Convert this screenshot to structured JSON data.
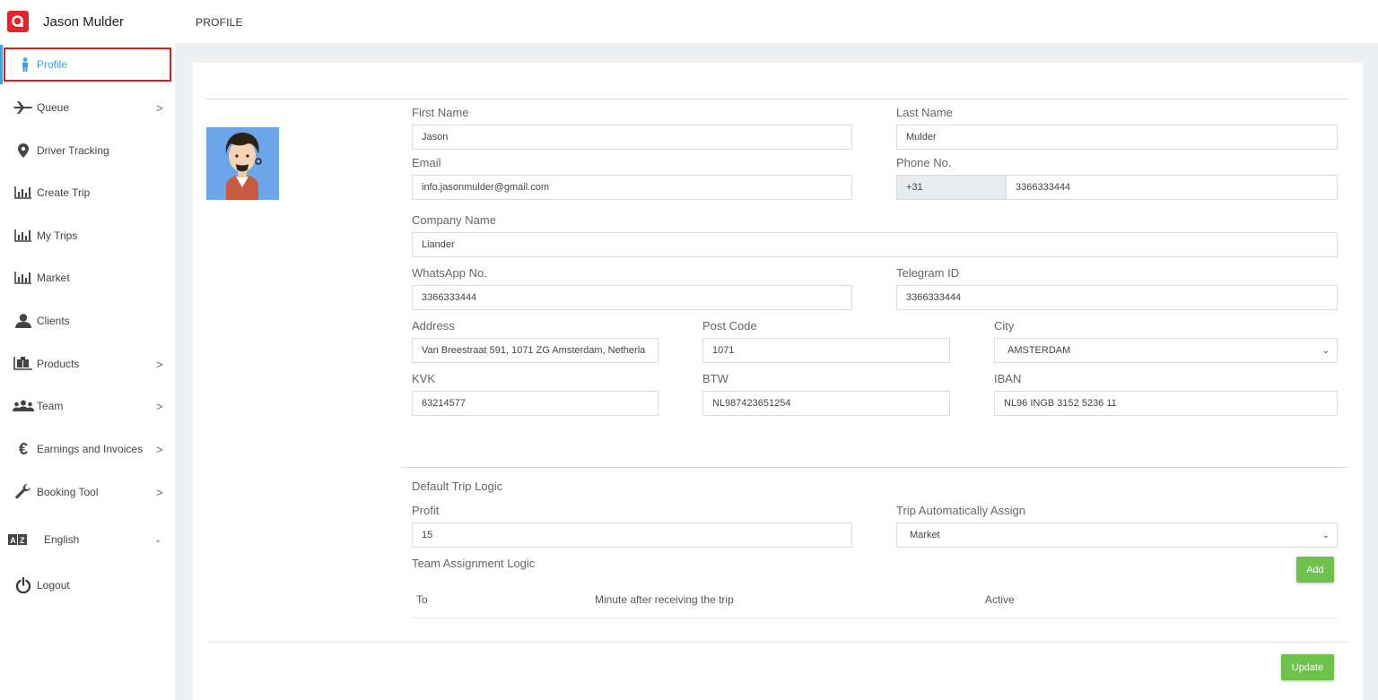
{
  "app": {
    "user_name": "Jason Mulder"
  },
  "topbar": {
    "breadcrumb": "PROFILE"
  },
  "sidebar": {
    "items": [
      {
        "label": "Profile",
        "icon": "person-icon"
      },
      {
        "label": "Queue",
        "icon": "plane-icon"
      },
      {
        "label": "Driver Tracking",
        "icon": "map-pin-icon"
      },
      {
        "label": "Create Trip",
        "icon": "bar-chart-icon"
      },
      {
        "label": "My Trips",
        "icon": "bar-chart-icon"
      },
      {
        "label": "Market",
        "icon": "bar-chart-icon"
      },
      {
        "label": "Clients",
        "icon": "user-icon"
      },
      {
        "label": "Products",
        "icon": "products-icon"
      },
      {
        "label": "Team",
        "icon": "team-icon"
      },
      {
        "label": "Earnings and Invoices",
        "icon": "euro-icon"
      },
      {
        "label": "Booking Tool",
        "icon": "wrench-icon"
      },
      {
        "label": "English",
        "icon": "translate-icon"
      },
      {
        "label": "Logout",
        "icon": "power-icon"
      }
    ]
  },
  "form": {
    "first_name": {
      "label": "First Name",
      "value": "Jason"
    },
    "last_name": {
      "label": "Last Name",
      "value": "Mulder"
    },
    "email": {
      "label": "Email",
      "value": "info.jasonmulder@gmail.com"
    },
    "phone": {
      "label": "Phone No.",
      "prefix": "+31",
      "value": "3366333444"
    },
    "company": {
      "label": "Company Name",
      "value": "Liander"
    },
    "whatsapp": {
      "label": "WhatsApp No.",
      "value": "3366333444"
    },
    "telegram": {
      "label": "Telegram ID",
      "value": "3366333444"
    },
    "address": {
      "label": "Address",
      "value": "Van Breestraat 591, 1071 ZG Amsterdam, Netherla"
    },
    "postcode": {
      "label": "Post Code",
      "value": "1071"
    },
    "city": {
      "label": "City",
      "value": "AMSTERDAM"
    },
    "kvk": {
      "label": "KVK",
      "value": "63214577"
    },
    "btw": {
      "label": "BTW",
      "value": "NL987423651254"
    },
    "iban": {
      "label": "IBAN",
      "value": "NL96 INGB 3152 5236 11"
    }
  },
  "trip_logic": {
    "section_title": "Default Trip Logic",
    "profit": {
      "label": "Profit",
      "value": "15"
    },
    "auto_assign": {
      "label": "Trip Automatically Assign",
      "value": "Market"
    },
    "team_logic_title": "Team Assignment Logic",
    "add_label": "Add",
    "columns": [
      "To",
      "Minute after receiving the trip",
      "Active"
    ]
  },
  "update_label": "Update",
  "colors": {
    "accent": "#3aa4dc",
    "brand": "#e0262b",
    "button": "#6cc24a",
    "highlight_border": "#e21b1b"
  }
}
